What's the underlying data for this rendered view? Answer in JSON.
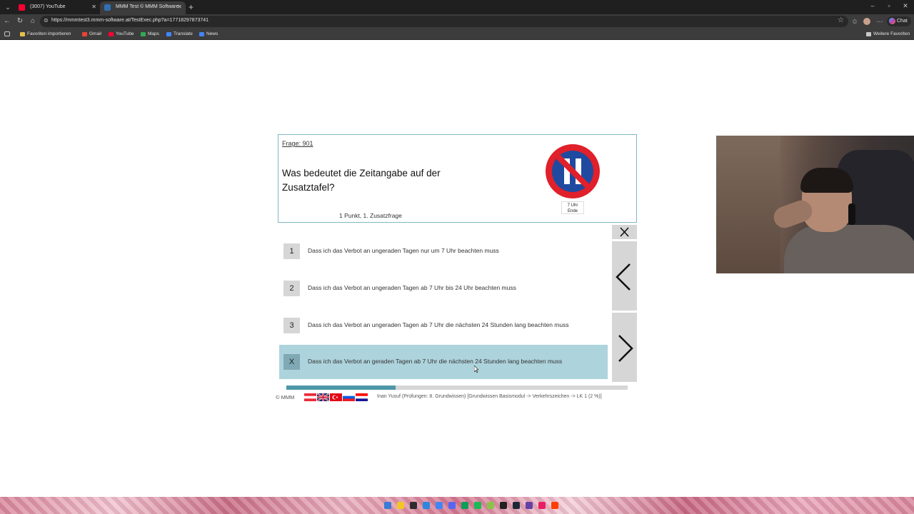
{
  "browser": {
    "tabs": [
      {
        "title": "(3007) YouTube",
        "active": false,
        "favicon_color": "#ff0033"
      },
      {
        "title": "MMM Test © MMM Software 20…",
        "active": true,
        "favicon_color": "#2f6fb3"
      }
    ],
    "url": "https://mmmtest3.mmm-software.at/TestExec.php?a=17718297873741",
    "bookmarks": [
      {
        "label": "Favoriten importieren",
        "icon_color": "#e3c04a"
      },
      {
        "label": "Gmail",
        "icon_color": "#ea4335"
      },
      {
        "label": "YouTube",
        "icon_color": "#ff0033"
      },
      {
        "label": "Maps",
        "icon_color": "#34a853"
      },
      {
        "label": "Translate",
        "icon_color": "#4285f4"
      },
      {
        "label": "News",
        "icon_color": "#4285f4"
      }
    ],
    "other_bookmarks": "Weitere Favoriten",
    "chat_label": "Chat"
  },
  "question": {
    "number_label": "Frage: 901",
    "text": "Was bedeutet die Zeitangabe auf der Zusatztafel?",
    "points_label": "1 Punkt, 1. Zusatzfrage",
    "sign_icon": "no-parking-odd-days-sign-icon",
    "zusatz_line1": "7 Uhr",
    "zusatz_line2": "Ende"
  },
  "answers": [
    {
      "marker": "1",
      "text": "Dass ich das Verbot an ungeraden Tagen nur um 7 Uhr beachten muss",
      "selected": false
    },
    {
      "marker": "2",
      "text": "Dass ich das Verbot an ungeraden Tagen ab 7 Uhr bis 24 Uhr beachten muss",
      "selected": false
    },
    {
      "marker": "3",
      "text": "Dass ich das Verbot an ungeraden Tagen ab 7 Uhr die nächsten 24 Stunden lang beachten muss",
      "selected": false
    },
    {
      "marker": "X",
      "text": "Dass ich das Verbot an geraden Tagen ab 7 Uhr die nächsten 24 Stunden lang beachten muss",
      "selected": true
    }
  ],
  "progress": {
    "fraction": 0.32
  },
  "footer": {
    "copyright": "© MMM",
    "info": "Inan Yusuf (Prüfungen: 8. Grundwissen) [Grundwissen Basismodul -> Verkehrszeichen -> LK 1 (2 %)]"
  },
  "colors": {
    "accent": "#4d97a8",
    "selected_bg": "#add3dc",
    "card_border": "#7fb6c6",
    "nav_button": "#d6d6d6"
  }
}
